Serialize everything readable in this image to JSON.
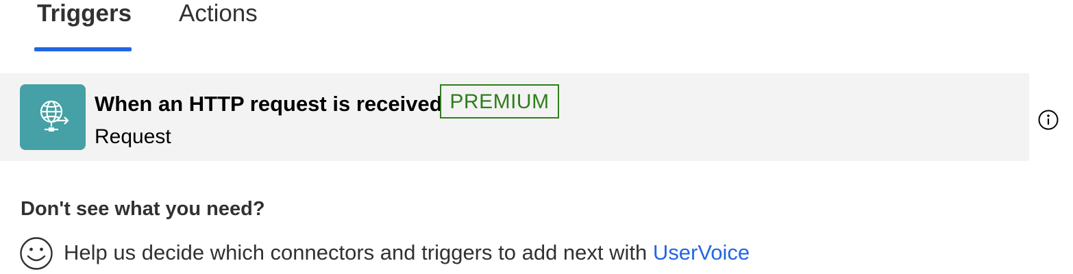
{
  "tabs": {
    "triggers_label": "Triggers",
    "actions_label": "Actions",
    "active": "Triggers"
  },
  "trigger": {
    "title": "When an HTTP request is received",
    "badge": "PREMIUM",
    "connector": "Request",
    "icon": "globe-request-icon",
    "tile_color": "#45a1a5"
  },
  "help": {
    "heading": "Don't see what you need?",
    "text": "Help us decide which connectors and triggers to add next with ",
    "link_label": "UserVoice"
  },
  "colors": {
    "accent": "#2266e3",
    "premium": "#2f7d1c",
    "row_background": "#f3f3f3"
  }
}
